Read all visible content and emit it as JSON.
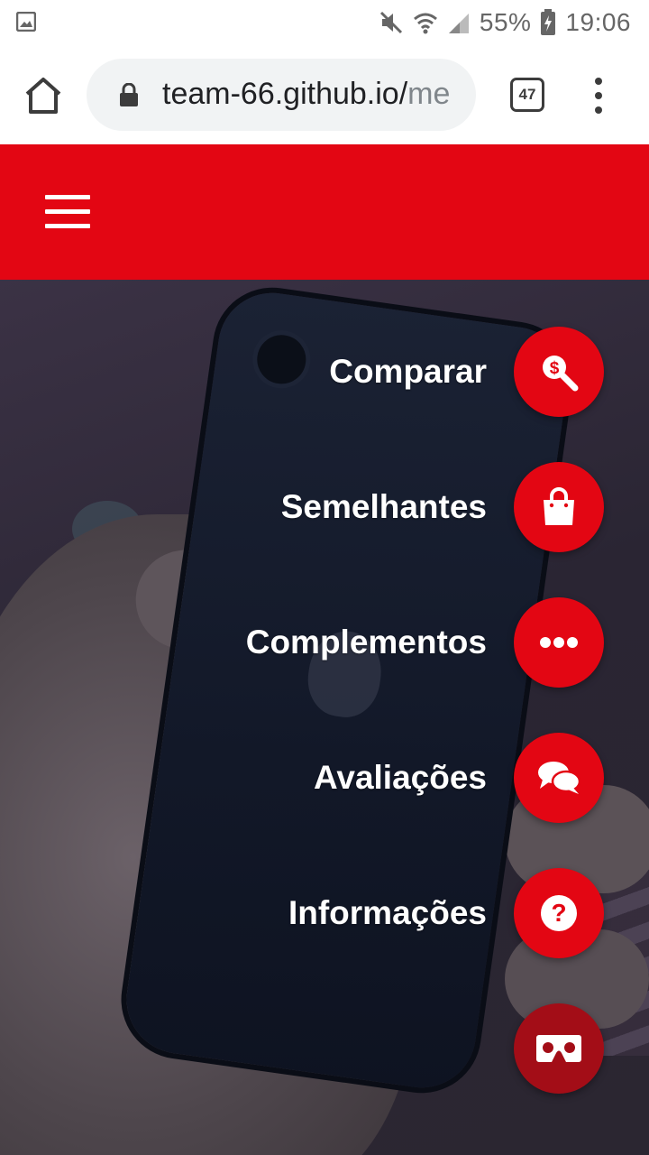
{
  "status_bar": {
    "battery": "55%",
    "time": "19:06"
  },
  "browser": {
    "url_main": "team-66.github.io/",
    "url_faded": "me",
    "tab_count": "47"
  },
  "menu": {
    "items": [
      {
        "label": "Comparar",
        "icon": "search-dollar-icon"
      },
      {
        "label": "Semelhantes",
        "icon": "shopping-bag-icon"
      },
      {
        "label": "Complementos",
        "icon": "ellipsis-icon"
      },
      {
        "label": "Avaliações",
        "icon": "comments-icon"
      },
      {
        "label": "Informações",
        "icon": "question-circle-icon"
      }
    ],
    "toggle_icon": "vr-cardboard-icon"
  },
  "colors": {
    "brand_red": "#e30613",
    "fab_dark": "#a30d17",
    "text_light": "#ffffff"
  }
}
